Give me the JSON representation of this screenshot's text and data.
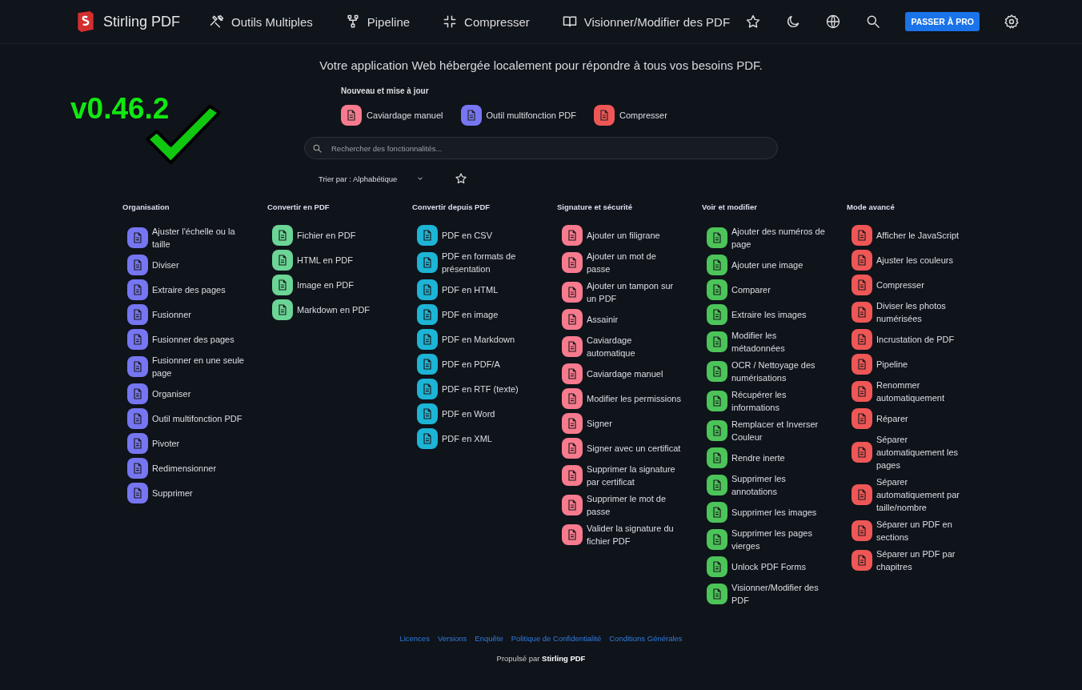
{
  "header": {
    "brand": "Stirling PDF",
    "nav": [
      {
        "label": "Outils Multiples"
      },
      {
        "label": "Pipeline"
      },
      {
        "label": "Compresser"
      },
      {
        "label": "Visionner/Modifier des PDF"
      }
    ],
    "pro_button": "PASSER À PRO"
  },
  "version_badge": "v0.46.2",
  "tagline": "Votre application Web hébergée localement pour répondre à tous vos besoins PDF.",
  "new_updates": {
    "title": "Nouveau et mise à jour",
    "items": [
      {
        "label": "Caviardage manuel",
        "color": "#f77a8e"
      },
      {
        "label": "Outil multifonction PDF",
        "color": "#7676f2"
      },
      {
        "label": "Compresser",
        "color": "#ef5757"
      }
    ]
  },
  "search": {
    "placeholder": "Rechercher des fonctionnalités..."
  },
  "sort": {
    "value": "Trier par : Alphabétique"
  },
  "categories": [
    {
      "title": "Organisation",
      "color": "#7676f2",
      "items": [
        "Ajuster l'échelle ou la taille",
        "Diviser",
        "Extraire des pages",
        "Fusionner",
        "Fusionner des pages",
        "Fusionner en une seule page",
        "Organiser",
        "Outil multifonction PDF",
        "Pivoter",
        "Redimensionner",
        "Supprimer"
      ]
    },
    {
      "title": "Convertir en PDF",
      "color": "#6bd596",
      "items": [
        "Fichier en PDF",
        "HTML en PDF",
        "Image en PDF",
        "Markdown en PDF"
      ]
    },
    {
      "title": "Convertir depuis PDF",
      "color": "#1db4d6",
      "items": [
        "PDF en CSV",
        "PDF en formats de présentation",
        "PDF en HTML",
        "PDF en image",
        "PDF en Markdown",
        "PDF en PDF/A",
        "PDF en RTF (texte)",
        "PDF en Word",
        "PDF en XML"
      ]
    },
    {
      "title": "Signature et sécurité",
      "color": "#f77a8e",
      "items": [
        "Ajouter un filigrane",
        "Ajouter un mot de passe",
        "Ajouter un tampon sur un PDF",
        "Assainir",
        "Caviardage automatique",
        "Caviardage manuel",
        "Modifier les permissions",
        "Signer",
        "Signer avec un certificat",
        "Supprimer la signature par certificat",
        "Supprimer le mot de passe",
        "Valider la signature du fichier PDF"
      ]
    },
    {
      "title": "Voir et modifier",
      "color": "#4cc45a",
      "items": [
        "Ajouter des numéros de page",
        "Ajouter une image",
        "Comparer",
        "Extraire les images",
        "Modifier les métadonnées",
        "OCR / Nettoyage des numérisations",
        "Récupérer les informations",
        "Remplacer et Inverser Couleur",
        "Rendre inerte",
        "Supprimer les annotations",
        "Supprimer les images",
        "Supprimer les pages vierges",
        "Unlock PDF Forms",
        "Visionner/Modifier des PDF"
      ]
    },
    {
      "title": "Mode avancé",
      "color": "#ef5757",
      "items": [
        "Afficher le JavaScript",
        "Ajuster les couleurs",
        "Compresser",
        "Diviser les photos numérisées",
        "Incrustation de PDF",
        "Pipeline",
        "Renommer automatiquement",
        "Réparer",
        "Séparer automatiquement les pages",
        "Séparer automatiquement par taille/nombre",
        "Séparer un PDF en sections",
        "Séparer un PDF par chapitres"
      ]
    }
  ],
  "footer": {
    "links": [
      "Licences",
      "Versions",
      "Enquête",
      "Politique de Confidentialité",
      "Conditions Générales"
    ],
    "credit": "Propulsé par **Stirling PDF**"
  }
}
